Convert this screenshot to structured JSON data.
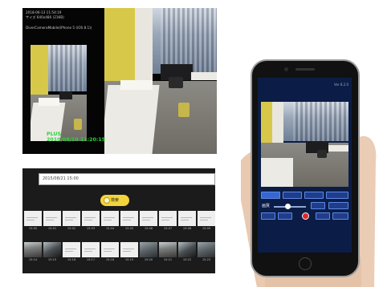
{
  "viewer": {
    "osd_line1": "2018-06-13 11:54:19",
    "osd_line2": "サイズ 640x480 (21KB)",
    "osd_line3": "DiverCameraMobile(iPhone 5 (iOS 8.1))",
    "stamp_line1": "PLUS",
    "stamp_line2": "2010/08/10 11:20:15"
  },
  "search": {
    "datetime_value": "2015/08/21 15:00",
    "search_button_label": "検索",
    "row1_times": [
      "15:00",
      "15:01",
      "15:02",
      "15:03",
      "15:04",
      "15:05",
      "15:06",
      "15:07",
      "15:08",
      "15:09"
    ],
    "row2_times": [
      "15:14",
      "15:15",
      "15:16",
      "15:17",
      "15:18",
      "15:19",
      "15:20",
      "15:21",
      "15:22",
      "15:23"
    ]
  },
  "phone": {
    "version": "Ver 8.2.0",
    "toolbar_row1": [
      "",
      "",
      "",
      ""
    ],
    "toolbar_row2_label": "画質",
    "toolbar_row3": [
      "",
      "",
      "",
      "",
      ""
    ]
  },
  "colors": {
    "timestamp_green": "#2bd33a",
    "search_button": "#f3d43b",
    "phone_ui_blue": "#1f3d8a",
    "record_red": "#e0252b"
  }
}
